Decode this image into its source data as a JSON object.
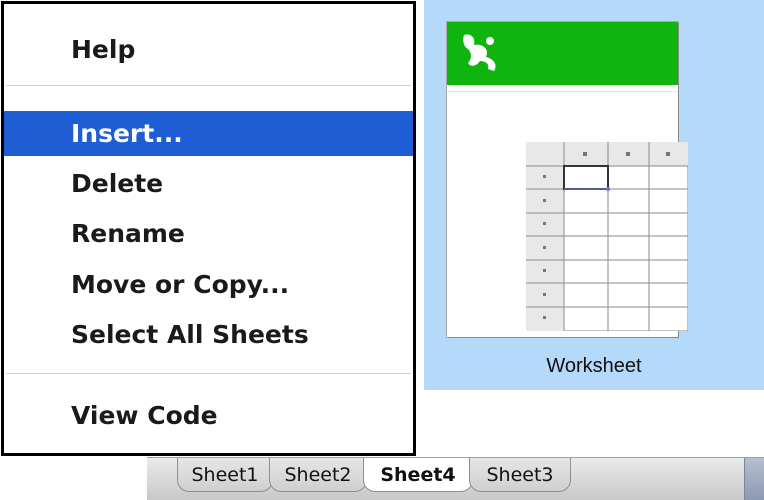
{
  "context_menu": {
    "items": [
      {
        "label": "Help"
      },
      {
        "label": "Insert...",
        "selected": true
      },
      {
        "label": "Delete"
      },
      {
        "label": "Rename"
      },
      {
        "label": "Move or Copy..."
      },
      {
        "label": "Select All Sheets"
      },
      {
        "label": "View Code"
      }
    ],
    "selection_color": "#1f5dd4"
  },
  "insert_preview": {
    "icon": "worksheet-icon",
    "caption": "Worksheet",
    "header_color": "#0fb40e",
    "background_color": "#b5d9f9"
  },
  "sheet_tabs": {
    "tabs": [
      {
        "label": "Sheet1"
      },
      {
        "label": "Sheet2"
      },
      {
        "label": "Sheet4",
        "active": true
      },
      {
        "label": "Sheet3"
      }
    ]
  }
}
